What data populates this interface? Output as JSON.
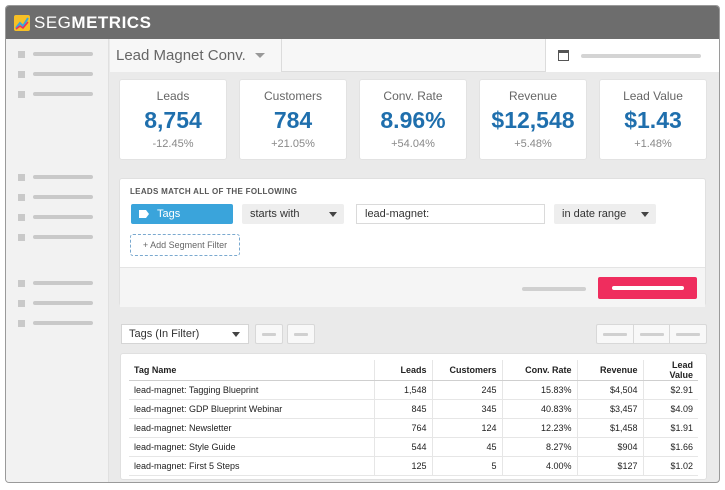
{
  "app": {
    "logo_light": "SEG",
    "logo_bold": "METRICS",
    "logo_colors": [
      "#f6c026",
      "#3aa4db",
      "#ef2d5e"
    ]
  },
  "report": {
    "selected": "Lead Magnet Conv."
  },
  "stats": [
    {
      "label": "Leads",
      "value": "8,754",
      "change": "-12.45%"
    },
    {
      "label": "Customers",
      "value": "784",
      "change": "+21.05%"
    },
    {
      "label": "Conv. Rate",
      "value": "8.96%",
      "change": "+54.04%"
    },
    {
      "label": "Revenue",
      "value": "$12,548",
      "change": "+5.48%"
    },
    {
      "label": "Lead Value",
      "value": "$1.43",
      "change": "+1.48%"
    }
  ],
  "filter": {
    "heading": "LEADS MATCH ALL OF THE FOLLOWING",
    "field": "Tags",
    "operator": "starts with",
    "value": "lead-magnet:",
    "range": "in date range",
    "add_label": "+ Add Segment Filter"
  },
  "grouping": {
    "selected": "Tags (In Filter)"
  },
  "table": {
    "headers": [
      "Tag Name",
      "Leads",
      "Customers",
      "Conv. Rate",
      "Revenue",
      "Lead Value"
    ],
    "rows": [
      [
        "lead-magnet: Tagging Blueprint",
        "1,548",
        "245",
        "15.83%",
        "$4,504",
        "$2.91"
      ],
      [
        "lead-magnet: GDP Blueprint Webinar",
        "845",
        "345",
        "40.83%",
        "$3,457",
        "$4.09"
      ],
      [
        "lead-magnet: Newsletter",
        "764",
        "124",
        "12.23%",
        "$1,458",
        "$1.91"
      ],
      [
        "lead-magnet: Style Guide",
        "544",
        "45",
        "8.27%",
        "$904",
        "$1.66"
      ],
      [
        "lead-magnet: First 5 Steps",
        "125",
        "5",
        "4.00%",
        "$127",
        "$1.02"
      ]
    ]
  },
  "colors": {
    "accent_blue": "#1f6fad",
    "tag_blue": "#3aa4db",
    "primary_button": "#ef2d5e",
    "titlebar": "#6d6d6d"
  }
}
